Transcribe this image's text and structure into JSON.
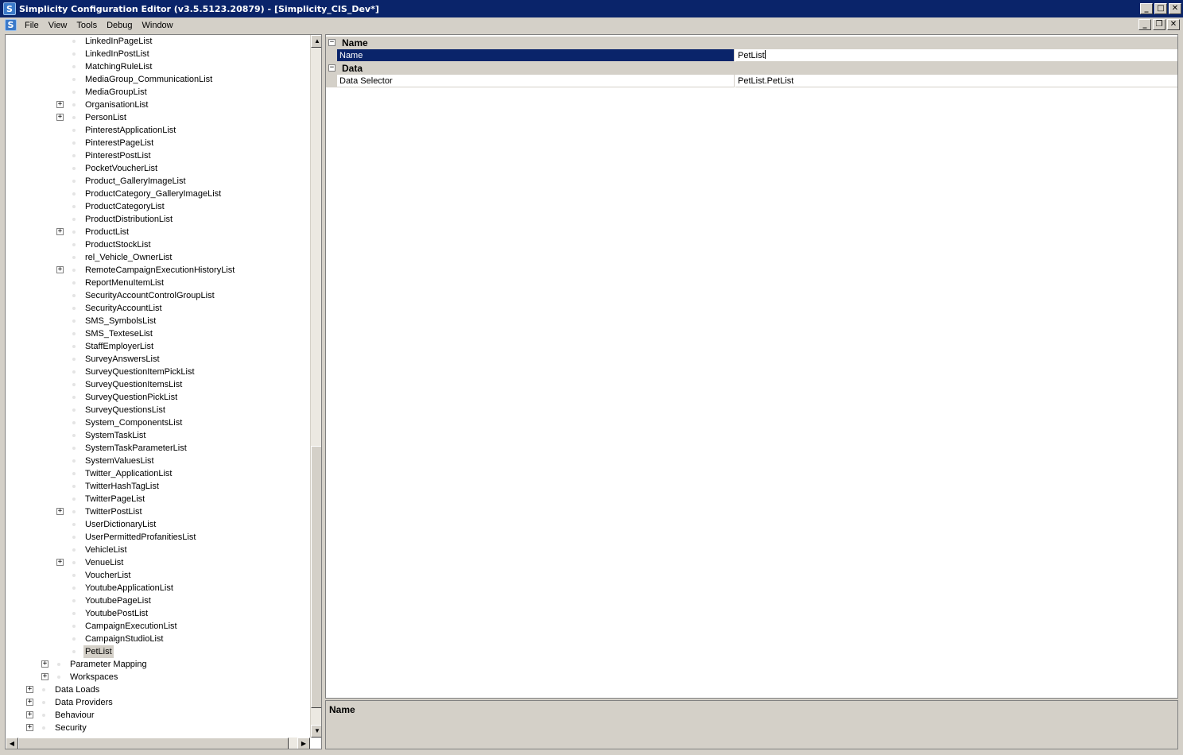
{
  "window": {
    "title": "Simplicity Configuration Editor (v3.5.5123.20879) - [Simplicity_CIS_Dev*]",
    "icon_letter": "S",
    "minimize_glyph": "_",
    "maximize_glyph": "□",
    "close_glyph": "✕",
    "restore_glyph": "❐"
  },
  "menu": [
    "File",
    "View",
    "Tools",
    "Debug",
    "Window"
  ],
  "tree": {
    "items": [
      {
        "label": "LinkedInPageList",
        "level": 3,
        "expandable": false
      },
      {
        "label": "LinkedInPostList",
        "level": 3,
        "expandable": false
      },
      {
        "label": "MatchingRuleList",
        "level": 3,
        "expandable": false
      },
      {
        "label": "MediaGroup_CommunicationList",
        "level": 3,
        "expandable": false
      },
      {
        "label": "MediaGroupList",
        "level": 3,
        "expandable": false
      },
      {
        "label": "OrganisationList",
        "level": 3,
        "expandable": true
      },
      {
        "label": "PersonList",
        "level": 3,
        "expandable": true
      },
      {
        "label": "PinterestApplicationList",
        "level": 3,
        "expandable": false
      },
      {
        "label": "PinterestPageList",
        "level": 3,
        "expandable": false
      },
      {
        "label": "PinterestPostList",
        "level": 3,
        "expandable": false
      },
      {
        "label": "PocketVoucherList",
        "level": 3,
        "expandable": false
      },
      {
        "label": "Product_GalleryImageList",
        "level": 3,
        "expandable": false
      },
      {
        "label": "ProductCategory_GalleryImageList",
        "level": 3,
        "expandable": false
      },
      {
        "label": "ProductCategoryList",
        "level": 3,
        "expandable": false
      },
      {
        "label": "ProductDistributionList",
        "level": 3,
        "expandable": false
      },
      {
        "label": "ProductList",
        "level": 3,
        "expandable": true
      },
      {
        "label": "ProductStockList",
        "level": 3,
        "expandable": false
      },
      {
        "label": "rel_Vehicle_OwnerList",
        "level": 3,
        "expandable": false
      },
      {
        "label": "RemoteCampaignExecutionHistoryList",
        "level": 3,
        "expandable": true
      },
      {
        "label": "ReportMenuItemList",
        "level": 3,
        "expandable": false
      },
      {
        "label": "SecurityAccountControlGroupList",
        "level": 3,
        "expandable": false
      },
      {
        "label": "SecurityAccountList",
        "level": 3,
        "expandable": false
      },
      {
        "label": "SMS_SymbolsList",
        "level": 3,
        "expandable": false
      },
      {
        "label": "SMS_TexteseList",
        "level": 3,
        "expandable": false
      },
      {
        "label": "StaffEmployerList",
        "level": 3,
        "expandable": false
      },
      {
        "label": "SurveyAnswersList",
        "level": 3,
        "expandable": false
      },
      {
        "label": "SurveyQuestionItemPickList",
        "level": 3,
        "expandable": false
      },
      {
        "label": "SurveyQuestionItemsList",
        "level": 3,
        "expandable": false
      },
      {
        "label": "SurveyQuestionPickList",
        "level": 3,
        "expandable": false
      },
      {
        "label": "SurveyQuestionsList",
        "level": 3,
        "expandable": false
      },
      {
        "label": "System_ComponentsList",
        "level": 3,
        "expandable": false
      },
      {
        "label": "SystemTaskList",
        "level": 3,
        "expandable": false
      },
      {
        "label": "SystemTaskParameterList",
        "level": 3,
        "expandable": false
      },
      {
        "label": "SystemValuesList",
        "level": 3,
        "expandable": false
      },
      {
        "label": "Twitter_ApplicationList",
        "level": 3,
        "expandable": false
      },
      {
        "label": "TwitterHashTagList",
        "level": 3,
        "expandable": false
      },
      {
        "label": "TwitterPageList",
        "level": 3,
        "expandable": false
      },
      {
        "label": "TwitterPostList",
        "level": 3,
        "expandable": true
      },
      {
        "label": "UserDictionaryList",
        "level": 3,
        "expandable": false
      },
      {
        "label": "UserPermittedProfanitiesList",
        "level": 3,
        "expandable": false
      },
      {
        "label": "VehicleList",
        "level": 3,
        "expandable": false
      },
      {
        "label": "VenueList",
        "level": 3,
        "expandable": true
      },
      {
        "label": "VoucherList",
        "level": 3,
        "expandable": false
      },
      {
        "label": "YoutubeApplicationList",
        "level": 3,
        "expandable": false
      },
      {
        "label": "YoutubePageList",
        "level": 3,
        "expandable": false
      },
      {
        "label": "YoutubePostList",
        "level": 3,
        "expandable": false
      },
      {
        "label": "CampaignExecutionList",
        "level": 3,
        "expandable": false
      },
      {
        "label": "CampaignStudioList",
        "level": 3,
        "expandable": false
      },
      {
        "label": "PetList",
        "level": 3,
        "expandable": false,
        "selected": true
      },
      {
        "label": "Parameter Mapping",
        "level": 2,
        "expandable": true
      },
      {
        "label": "Workspaces",
        "level": 2,
        "expandable": true
      },
      {
        "label": "Data Loads",
        "level": 1,
        "expandable": true
      },
      {
        "label": "Data Providers",
        "level": 1,
        "expandable": true
      },
      {
        "label": "Behaviour",
        "level": 1,
        "expandable": true
      },
      {
        "label": "Security",
        "level": 1,
        "expandable": true
      }
    ]
  },
  "scrollbar": {
    "up_glyph": "▲",
    "down_glyph": "▼",
    "left_glyph": "◀",
    "right_glyph": "▶",
    "vertical_position": 0.96
  },
  "properties": {
    "categories": [
      {
        "name": "Name",
        "rows": [
          {
            "name": "Name",
            "value": "PetList",
            "selected": true,
            "editing": true
          }
        ]
      },
      {
        "name": "Data",
        "rows": [
          {
            "name": "Data Selector",
            "value": "PetList.PetList",
            "selected": false
          }
        ]
      }
    ],
    "expander_minus": "−",
    "expander_plus": "+"
  },
  "help": {
    "title": "Name"
  }
}
